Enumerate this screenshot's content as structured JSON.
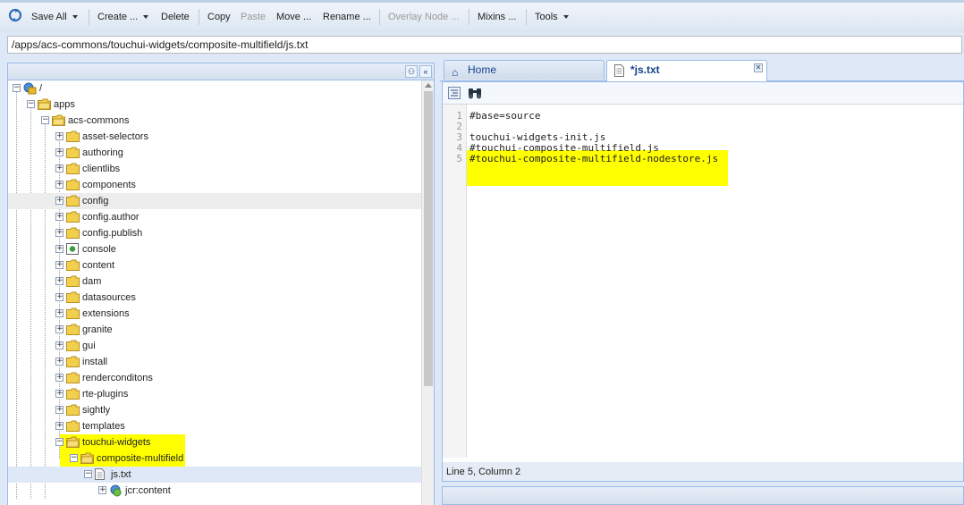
{
  "toolbar": {
    "save_all": "Save All",
    "create": "Create ...",
    "delete": "Delete",
    "copy": "Copy",
    "paste": "Paste",
    "move": "Move ...",
    "rename": "Rename ...",
    "overlay_node": "Overlay Node ...",
    "mixins": "Mixins ...",
    "tools": "Tools"
  },
  "path": {
    "value": "/apps/acs-commons/touchui-widgets/composite-multifield/js.txt"
  },
  "tree": {
    "root": "/",
    "apps": "apps",
    "acs_commons": "acs-commons",
    "children": [
      "asset-selectors",
      "authoring",
      "clientlibs",
      "components",
      "config",
      "config.author",
      "config.publish",
      "console",
      "content",
      "dam",
      "datasources",
      "extensions",
      "granite",
      "gui",
      "install",
      "renderconditons",
      "rte-plugins",
      "sightly",
      "templates",
      "touchui-widgets"
    ],
    "composite_multifield": "composite-multifield",
    "js_txt": "js.txt",
    "jcr_content": "jcr:content"
  },
  "tabs": {
    "home": "Home",
    "file": "*js.txt"
  },
  "editor": {
    "lines": [
      {
        "n": "1",
        "text": "#base=source"
      },
      {
        "n": "2",
        "text": ""
      },
      {
        "n": "3",
        "text": "touchui-widgets-init.js"
      },
      {
        "n": "4",
        "text": "#touchui-composite-multifield.js"
      },
      {
        "n": "5",
        "text": "#touchui-composite-multifield-nodestore.js"
      }
    ],
    "status": "Line 5, Column 2"
  },
  "colors": {
    "highlight": "#ffff00",
    "panel_border": "#99bbe8",
    "folder": "#e9b826"
  }
}
